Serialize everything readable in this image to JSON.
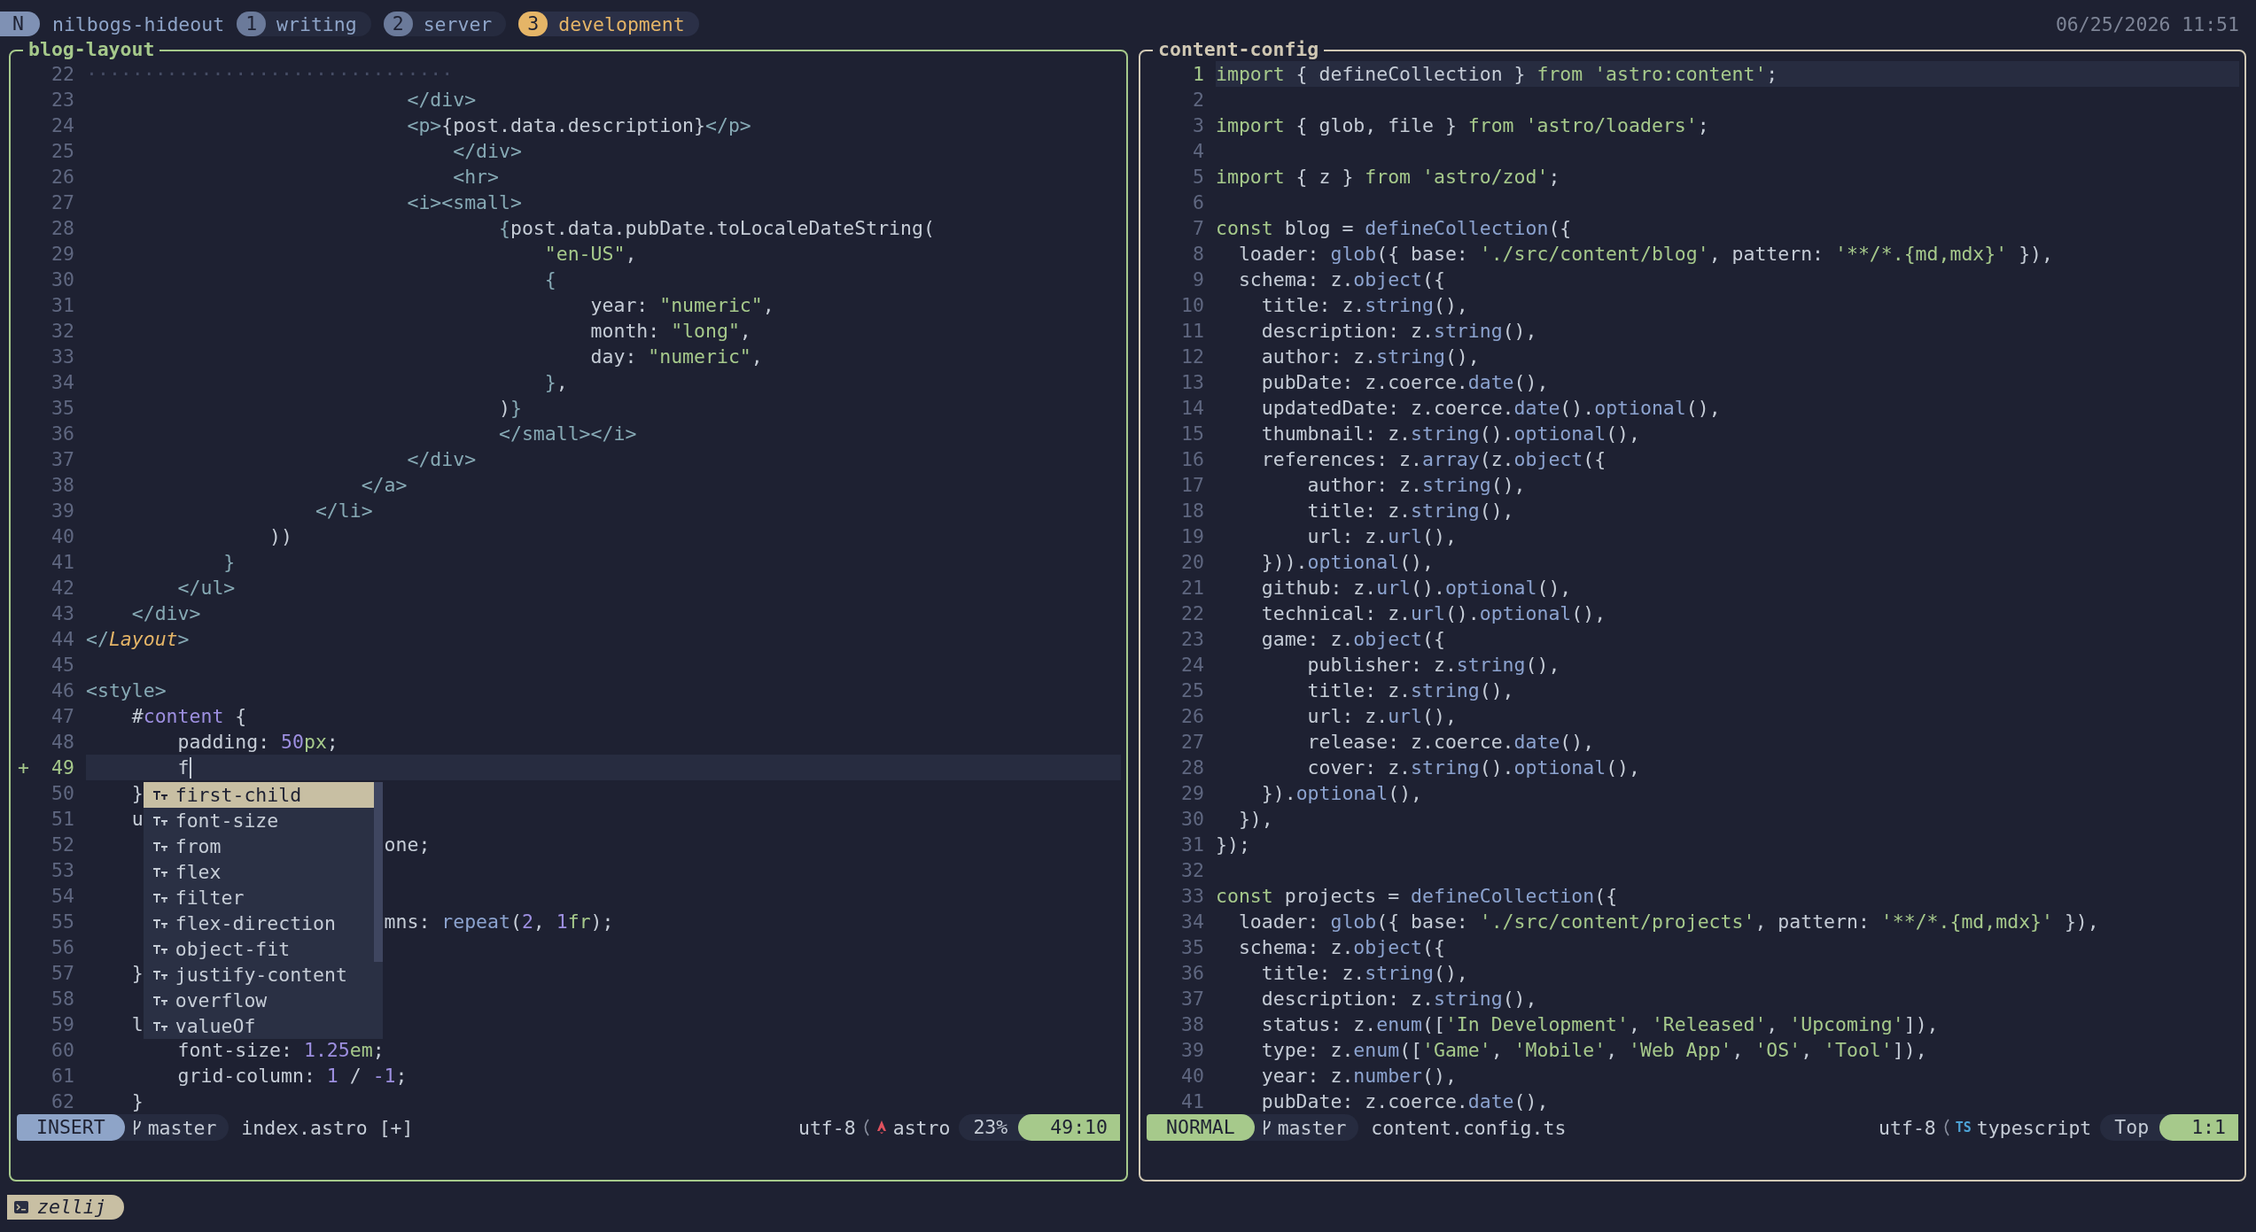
{
  "tab_bar": {
    "mode": "N",
    "session": "nilbogs-hideout",
    "tabs": [
      {
        "number": "1",
        "label": "writing",
        "selected": false
      },
      {
        "number": "2",
        "label": "server",
        "selected": false
      },
      {
        "number": "3",
        "label": "development",
        "selected": true
      }
    ],
    "clock": "06/25/2026 11:51"
  },
  "panes": [
    {
      "title": "blog-layout",
      "focused": true,
      "lines": [
        {
          "number": "22",
          "current": false,
          "tokens": [
            {
              "text": "································",
              "kind": "fold"
            }
          ]
        },
        {
          "number": "23",
          "current": false,
          "tokens": [
            {
              "text": "                            </div>",
              "kind": "tag"
            }
          ]
        },
        {
          "number": "24",
          "current": false,
          "tokens": [
            {
              "text": "                            <p>",
              "kind": "tag"
            },
            {
              "text": "{post.data.description}",
              "kind": "plain"
            },
            {
              "text": "</p>",
              "kind": "tag"
            }
          ]
        },
        {
          "number": "25",
          "current": false,
          "tokens": [
            {
              "text": "                                </div>",
              "kind": "tag"
            }
          ]
        },
        {
          "number": "26",
          "current": false,
          "tokens": [
            {
              "text": "                                <hr>",
              "kind": "tag"
            }
          ]
        },
        {
          "number": "27",
          "current": false,
          "tokens": [
            {
              "text": "                            <i><small>",
              "kind": "tag"
            }
          ]
        },
        {
          "number": "28",
          "current": false,
          "tokens": [
            {
              "text": "                                    {",
              "kind": "tag"
            },
            {
              "text": "post.data.pubDate.toLocaleDateString(",
              "kind": "plain"
            }
          ]
        },
        {
          "number": "29",
          "current": false,
          "tokens": [
            {
              "text": "                                        \"en-US\"",
              "kind": "str"
            },
            {
              "text": ",",
              "kind": "plain"
            }
          ]
        },
        {
          "number": "30",
          "current": false,
          "tokens": [
            {
              "text": "                                        {",
              "kind": "tag"
            }
          ]
        },
        {
          "number": "31",
          "current": false,
          "tokens": [
            {
              "text": "                                            year: ",
              "kind": "plain"
            },
            {
              "text": "\"numeric\"",
              "kind": "str"
            },
            {
              "text": ",",
              "kind": "plain"
            }
          ]
        },
        {
          "number": "32",
          "current": false,
          "tokens": [
            {
              "text": "                                            month: ",
              "kind": "plain"
            },
            {
              "text": "\"long\"",
              "kind": "str"
            },
            {
              "text": ",",
              "kind": "plain"
            }
          ]
        },
        {
          "number": "33",
          "current": false,
          "tokens": [
            {
              "text": "                                            day: ",
              "kind": "plain"
            },
            {
              "text": "\"numeric\"",
              "kind": "str"
            },
            {
              "text": ",",
              "kind": "plain"
            }
          ]
        },
        {
          "number": "34",
          "current": false,
          "tokens": [
            {
              "text": "                                        }",
              "kind": "tag"
            },
            {
              "text": ",",
              "kind": "plain"
            }
          ]
        },
        {
          "number": "35",
          "current": false,
          "tokens": [
            {
              "text": "                                    )",
              "kind": "plain"
            },
            {
              "text": "}",
              "kind": "tag"
            }
          ]
        },
        {
          "number": "36",
          "current": false,
          "tokens": [
            {
              "text": "                                    </small></i>",
              "kind": "tag"
            }
          ]
        },
        {
          "number": "37",
          "current": false,
          "tokens": [
            {
              "text": "                            </div>",
              "kind": "tag"
            }
          ]
        },
        {
          "number": "38",
          "current": false,
          "tokens": [
            {
              "text": "                        </a>",
              "kind": "tag"
            }
          ]
        },
        {
          "number": "39",
          "current": false,
          "tokens": [
            {
              "text": "                    </li>",
              "kind": "tag"
            }
          ]
        },
        {
          "number": "40",
          "current": false,
          "tokens": [
            {
              "text": "                ))",
              "kind": "plain"
            }
          ]
        },
        {
          "number": "41",
          "current": false,
          "tokens": [
            {
              "text": "            }",
              "kind": "tag"
            }
          ]
        },
        {
          "number": "42",
          "current": false,
          "tokens": [
            {
              "text": "        </ul>",
              "kind": "tag"
            }
          ]
        },
        {
          "number": "43",
          "current": false,
          "tokens": [
            {
              "text": "    </div>",
              "kind": "tag"
            }
          ]
        },
        {
          "number": "44",
          "current": false,
          "tokens": [
            {
              "text": "</",
              "kind": "tag"
            },
            {
              "text": "Layout",
              "kind": "comp"
            },
            {
              "text": ">",
              "kind": "tag"
            }
          ]
        },
        {
          "number": "45",
          "current": false
        },
        {
          "number": "46",
          "current": false,
          "tokens": [
            {
              "text": "<style>",
              "kind": "tag"
            }
          ]
        },
        {
          "number": "47",
          "current": false,
          "tokens": [
            {
              "text": "    #",
              "kind": "plain"
            },
            {
              "text": "content",
              "kind": "num"
            },
            {
              "text": " {",
              "kind": "plain"
            }
          ]
        },
        {
          "number": "48",
          "current": false,
          "tokens": [
            {
              "text": "        padding: ",
              "kind": "plain"
            },
            {
              "text": "50",
              "kind": "num"
            },
            {
              "text": "px",
              "kind": "str"
            },
            {
              "text": ";",
              "kind": "plain"
            }
          ]
        },
        {
          "number": "49",
          "current": true,
          "sign": "+",
          "tokens": [
            {
              "text": "        f",
              "kind": "plain"
            }
          ]
        },
        {
          "number": "50",
          "current": false,
          "tokens": [
            {
              "text": "    }",
              "kind": "plain"
            }
          ]
        },
        {
          "number": "51",
          "current": false,
          "tokens": [
            {
              "text": "    u",
              "kind": "plain"
            }
          ]
        },
        {
          "number": "52",
          "current": false,
          "tokens": [
            {
              "text": "                          one;",
              "kind": "plain"
            }
          ]
        },
        {
          "number": "53",
          "current": false
        },
        {
          "number": "54",
          "current": false
        },
        {
          "number": "55",
          "current": false,
          "tokens": [
            {
              "text": "                          mns: ",
              "kind": "plain"
            },
            {
              "text": "repeat",
              "kind": "fn"
            },
            {
              "text": "(",
              "kind": "plain"
            },
            {
              "text": "2",
              "kind": "num"
            },
            {
              "text": ", ",
              "kind": "plain"
            },
            {
              "text": "1",
              "kind": "num"
            },
            {
              "text": "fr",
              "kind": "str"
            },
            {
              "text": ");",
              "kind": "plain"
            }
          ]
        },
        {
          "number": "56",
          "current": false
        },
        {
          "number": "57",
          "current": false,
          "tokens": [
            {
              "text": "    }",
              "kind": "plain"
            }
          ]
        },
        {
          "number": "58",
          "current": false
        },
        {
          "number": "59",
          "current": false,
          "tokens": [
            {
              "text": "    l",
              "kind": "plain"
            }
          ]
        },
        {
          "number": "60",
          "current": false,
          "tokens": [
            {
              "text": "        font-size: ",
              "kind": "plain"
            },
            {
              "text": "1.25",
              "kind": "num"
            },
            {
              "text": "em",
              "kind": "str"
            },
            {
              "text": ";",
              "kind": "plain"
            }
          ]
        },
        {
          "number": "61",
          "current": false,
          "tokens": [
            {
              "text": "        grid-column: ",
              "kind": "plain"
            },
            {
              "text": "1",
              "kind": "num"
            },
            {
              "text": " / ",
              "kind": "plain"
            },
            {
              "text": "-1",
              "kind": "num"
            },
            {
              "text": ";",
              "kind": "plain"
            }
          ]
        },
        {
          "number": "62",
          "current": false,
          "tokens": [
            {
              "text": "    }",
              "kind": "plain"
            }
          ]
        }
      ],
      "completion": {
        "items": [
          {
            "label": "first-child",
            "selected": true
          },
          {
            "label": "font-size",
            "selected": false
          },
          {
            "label": "from",
            "selected": false
          },
          {
            "label": "flex",
            "selected": false
          },
          {
            "label": "filter",
            "selected": false
          },
          {
            "label": "flex-direction",
            "selected": false
          },
          {
            "label": "object-fit",
            "selected": false
          },
          {
            "label": "justify-content",
            "selected": false
          },
          {
            "label": "overflow",
            "selected": false
          },
          {
            "label": "valueOf",
            "selected": false
          }
        ]
      },
      "status": {
        "mode": {
          "label": "INSERT",
          "kind": "insert"
        },
        "branch": "master",
        "file": "index.astro [+]",
        "encoding": "utf-8",
        "filetype_icon": {
          "kind": "astro"
        },
        "filetype": "astro",
        "progress": "23%",
        "position": "49:10"
      }
    },
    {
      "title": "content-config",
      "focused": false,
      "lines": [
        {
          "number": "1",
          "current": true,
          "tokens": [
            {
              "text": "import",
              "kind": "kw"
            },
            {
              "text": " { defineCollection } ",
              "kind": "plain"
            },
            {
              "text": "from",
              "kind": "kw"
            },
            {
              "text": " 'astro:content'",
              "kind": "str"
            },
            {
              "text": ";",
              "kind": "plain"
            }
          ]
        },
        {
          "number": "2",
          "current": false
        },
        {
          "number": "3",
          "current": false,
          "tokens": [
            {
              "text": "import",
              "kind": "kw"
            },
            {
              "text": " { glob, file } ",
              "kind": "plain"
            },
            {
              "text": "from",
              "kind": "kw"
            },
            {
              "text": " 'astro/loaders'",
              "kind": "str"
            },
            {
              "text": ";",
              "kind": "plain"
            }
          ]
        },
        {
          "number": "4",
          "current": false
        },
        {
          "number": "5",
          "current": false,
          "tokens": [
            {
              "text": "import",
              "kind": "kw"
            },
            {
              "text": " { z } ",
              "kind": "plain"
            },
            {
              "text": "from",
              "kind": "kw"
            },
            {
              "text": " 'astro/zod'",
              "kind": "str"
            },
            {
              "text": ";",
              "kind": "plain"
            }
          ]
        },
        {
          "number": "6",
          "current": false
        },
        {
          "number": "7",
          "current": false,
          "tokens": [
            {
              "text": "const",
              "kind": "kw"
            },
            {
              "text": " blog = ",
              "kind": "plain"
            },
            {
              "text": "defineCollection",
              "kind": "fn"
            },
            {
              "text": "({",
              "kind": "plain"
            }
          ]
        },
        {
          "number": "8",
          "current": false,
          "tokens": [
            {
              "text": "  loader: ",
              "kind": "plain"
            },
            {
              "text": "glob",
              "kind": "fn"
            },
            {
              "text": "({ base: ",
              "kind": "plain"
            },
            {
              "text": "'./src/content/blog'",
              "kind": "str"
            },
            {
              "text": ", pattern: ",
              "kind": "plain"
            },
            {
              "text": "'**/*.{md,mdx}'",
              "kind": "str"
            },
            {
              "text": " }),",
              "kind": "plain"
            }
          ]
        },
        {
          "number": "9",
          "current": false,
          "tokens": [
            {
              "text": "  schema: z.",
              "kind": "plain"
            },
            {
              "text": "object",
              "kind": "fn"
            },
            {
              "text": "({",
              "kind": "plain"
            }
          ]
        },
        {
          "number": "10",
          "current": false,
          "tokens": [
            {
              "text": "    title: z.",
              "kind": "plain"
            },
            {
              "text": "string",
              "kind": "fn"
            },
            {
              "text": "(),",
              "kind": "plain"
            }
          ]
        },
        {
          "number": "11",
          "current": false,
          "tokens": [
            {
              "text": "    description: z.",
              "kind": "plain"
            },
            {
              "text": "string",
              "kind": "fn"
            },
            {
              "text": "(),",
              "kind": "plain"
            }
          ]
        },
        {
          "number": "12",
          "current": false,
          "tokens": [
            {
              "text": "    author: z.",
              "kind": "plain"
            },
            {
              "text": "string",
              "kind": "fn"
            },
            {
              "text": "(),",
              "kind": "plain"
            }
          ]
        },
        {
          "number": "13",
          "current": false,
          "tokens": [
            {
              "text": "    pubDate: z.coerce.",
              "kind": "plain"
            },
            {
              "text": "date",
              "kind": "fn"
            },
            {
              "text": "(),",
              "kind": "plain"
            }
          ]
        },
        {
          "number": "14",
          "current": false,
          "tokens": [
            {
              "text": "    updatedDate: z.coerce.",
              "kind": "plain"
            },
            {
              "text": "date",
              "kind": "fn"
            },
            {
              "text": "().",
              "kind": "plain"
            },
            {
              "text": "optional",
              "kind": "fn"
            },
            {
              "text": "(),",
              "kind": "plain"
            }
          ]
        },
        {
          "number": "15",
          "current": false,
          "tokens": [
            {
              "text": "    thumbnail: z.",
              "kind": "plain"
            },
            {
              "text": "string",
              "kind": "fn"
            },
            {
              "text": "().",
              "kind": "plain"
            },
            {
              "text": "optional",
              "kind": "fn"
            },
            {
              "text": "(),",
              "kind": "plain"
            }
          ]
        },
        {
          "number": "16",
          "current": false,
          "tokens": [
            {
              "text": "    references: z.",
              "kind": "plain"
            },
            {
              "text": "array",
              "kind": "fn"
            },
            {
              "text": "(z.",
              "kind": "plain"
            },
            {
              "text": "object",
              "kind": "fn"
            },
            {
              "text": "({",
              "kind": "plain"
            }
          ]
        },
        {
          "number": "17",
          "current": false,
          "tokens": [
            {
              "text": "        author: z.",
              "kind": "plain"
            },
            {
              "text": "string",
              "kind": "fn"
            },
            {
              "text": "(),",
              "kind": "plain"
            }
          ]
        },
        {
          "number": "18",
          "current": false,
          "tokens": [
            {
              "text": "        title: z.",
              "kind": "plain"
            },
            {
              "text": "string",
              "kind": "fn"
            },
            {
              "text": "(),",
              "kind": "plain"
            }
          ]
        },
        {
          "number": "19",
          "current": false,
          "tokens": [
            {
              "text": "        url: z.",
              "kind": "plain"
            },
            {
              "text": "url",
              "kind": "fn"
            },
            {
              "text": "(),",
              "kind": "plain"
            }
          ]
        },
        {
          "number": "20",
          "current": false,
          "tokens": [
            {
              "text": "    })).",
              "kind": "plain"
            },
            {
              "text": "optional",
              "kind": "fn"
            },
            {
              "text": "(),",
              "kind": "plain"
            }
          ]
        },
        {
          "number": "21",
          "current": false,
          "tokens": [
            {
              "text": "    github: z.",
              "kind": "plain"
            },
            {
              "text": "url",
              "kind": "fn"
            },
            {
              "text": "().",
              "kind": "plain"
            },
            {
              "text": "optional",
              "kind": "fn"
            },
            {
              "text": "(),",
              "kind": "plain"
            }
          ]
        },
        {
          "number": "22",
          "current": false,
          "tokens": [
            {
              "text": "    technical: z.",
              "kind": "plain"
            },
            {
              "text": "url",
              "kind": "fn"
            },
            {
              "text": "().",
              "kind": "plain"
            },
            {
              "text": "optional",
              "kind": "fn"
            },
            {
              "text": "(),",
              "kind": "plain"
            }
          ]
        },
        {
          "number": "23",
          "current": false,
          "tokens": [
            {
              "text": "    game: z.",
              "kind": "plain"
            },
            {
              "text": "object",
              "kind": "fn"
            },
            {
              "text": "({",
              "kind": "plain"
            }
          ]
        },
        {
          "number": "24",
          "current": false,
          "tokens": [
            {
              "text": "        publisher: z.",
              "kind": "plain"
            },
            {
              "text": "string",
              "kind": "fn"
            },
            {
              "text": "(),",
              "kind": "plain"
            }
          ]
        },
        {
          "number": "25",
          "current": false,
          "tokens": [
            {
              "text": "        title: z.",
              "kind": "plain"
            },
            {
              "text": "string",
              "kind": "fn"
            },
            {
              "text": "(),",
              "kind": "plain"
            }
          ]
        },
        {
          "number": "26",
          "current": false,
          "tokens": [
            {
              "text": "        url: z.",
              "kind": "plain"
            },
            {
              "text": "url",
              "kind": "fn"
            },
            {
              "text": "(),",
              "kind": "plain"
            }
          ]
        },
        {
          "number": "27",
          "current": false,
          "tokens": [
            {
              "text": "        release: z.coerce.",
              "kind": "plain"
            },
            {
              "text": "date",
              "kind": "fn"
            },
            {
              "text": "(),",
              "kind": "plain"
            }
          ]
        },
        {
          "number": "28",
          "current": false,
          "tokens": [
            {
              "text": "        cover: z.",
              "kind": "plain"
            },
            {
              "text": "string",
              "kind": "fn"
            },
            {
              "text": "().",
              "kind": "plain"
            },
            {
              "text": "optional",
              "kind": "fn"
            },
            {
              "text": "(),",
              "kind": "plain"
            }
          ]
        },
        {
          "number": "29",
          "current": false,
          "tokens": [
            {
              "text": "    }).",
              "kind": "plain"
            },
            {
              "text": "optional",
              "kind": "fn"
            },
            {
              "text": "(),",
              "kind": "plain"
            }
          ]
        },
        {
          "number": "30",
          "current": false,
          "tokens": [
            {
              "text": "  }),",
              "kind": "plain"
            }
          ]
        },
        {
          "number": "31",
          "current": false,
          "tokens": [
            {
              "text": "});",
              "kind": "plain"
            }
          ]
        },
        {
          "number": "32",
          "current": false
        },
        {
          "number": "33",
          "current": false,
          "tokens": [
            {
              "text": "const",
              "kind": "kw"
            },
            {
              "text": " projects = ",
              "kind": "plain"
            },
            {
              "text": "defineCollection",
              "kind": "fn"
            },
            {
              "text": "({",
              "kind": "plain"
            }
          ]
        },
        {
          "number": "34",
          "current": false,
          "tokens": [
            {
              "text": "  loader: ",
              "kind": "plain"
            },
            {
              "text": "glob",
              "kind": "fn"
            },
            {
              "text": "({ base: ",
              "kind": "plain"
            },
            {
              "text": "'./src/content/projects'",
              "kind": "str"
            },
            {
              "text": ", pattern: ",
              "kind": "plain"
            },
            {
              "text": "'**/*.{md,mdx}'",
              "kind": "str"
            },
            {
              "text": " }),",
              "kind": "plain"
            }
          ]
        },
        {
          "number": "35",
          "current": false,
          "tokens": [
            {
              "text": "  schema: z.",
              "kind": "plain"
            },
            {
              "text": "object",
              "kind": "fn"
            },
            {
              "text": "({",
              "kind": "plain"
            }
          ]
        },
        {
          "number": "36",
          "current": false,
          "tokens": [
            {
              "text": "    title: z.",
              "kind": "plain"
            },
            {
              "text": "string",
              "kind": "fn"
            },
            {
              "text": "(),",
              "kind": "plain"
            }
          ]
        },
        {
          "number": "37",
          "current": false,
          "tokens": [
            {
              "text": "    description: z.",
              "kind": "plain"
            },
            {
              "text": "string",
              "kind": "fn"
            },
            {
              "text": "(),",
              "kind": "plain"
            }
          ]
        },
        {
          "number": "38",
          "current": false,
          "tokens": [
            {
              "text": "    status: z.",
              "kind": "plain"
            },
            {
              "text": "enum",
              "kind": "fn"
            },
            {
              "text": "([",
              "kind": "plain"
            },
            {
              "text": "'In Development'",
              "kind": "str"
            },
            {
              "text": ", ",
              "kind": "plain"
            },
            {
              "text": "'Released'",
              "kind": "str"
            },
            {
              "text": ", ",
              "kind": "plain"
            },
            {
              "text": "'Upcoming'",
              "kind": "str"
            },
            {
              "text": "]),",
              "kind": "plain"
            }
          ]
        },
        {
          "number": "39",
          "current": false,
          "tokens": [
            {
              "text": "    type: z.",
              "kind": "plain"
            },
            {
              "text": "enum",
              "kind": "fn"
            },
            {
              "text": "([",
              "kind": "plain"
            },
            {
              "text": "'Game'",
              "kind": "str"
            },
            {
              "text": ", ",
              "kind": "plain"
            },
            {
              "text": "'Mobile'",
              "kind": "str"
            },
            {
              "text": ", ",
              "kind": "plain"
            },
            {
              "text": "'Web App'",
              "kind": "str"
            },
            {
              "text": ", ",
              "kind": "plain"
            },
            {
              "text": "'OS'",
              "kind": "str"
            },
            {
              "text": ", ",
              "kind": "plain"
            },
            {
              "text": "'Tool'",
              "kind": "str"
            },
            {
              "text": "]),",
              "kind": "plain"
            }
          ]
        },
        {
          "number": "40",
          "current": false,
          "tokens": [
            {
              "text": "    year: z.",
              "kind": "plain"
            },
            {
              "text": "number",
              "kind": "fn"
            },
            {
              "text": "(),",
              "kind": "plain"
            }
          ]
        },
        {
          "number": "41",
          "current": false,
          "tokens": [
            {
              "text": "    pubDate: z.coerce.",
              "kind": "plain"
            },
            {
              "text": "date",
              "kind": "fn"
            },
            {
              "text": "(),",
              "kind": "plain"
            }
          ]
        }
      ],
      "status": {
        "mode": {
          "label": "NORMAL",
          "kind": "normal"
        },
        "branch": "master",
        "file": "content.config.ts",
        "encoding": "utf-8",
        "filetype_icon": {
          "kind": "ts",
          "text": "TS"
        },
        "filetype": "typescript",
        "progress": "Top",
        "position": "1:1"
      }
    }
  ],
  "bottom_bar": {
    "label": "zellij"
  }
}
